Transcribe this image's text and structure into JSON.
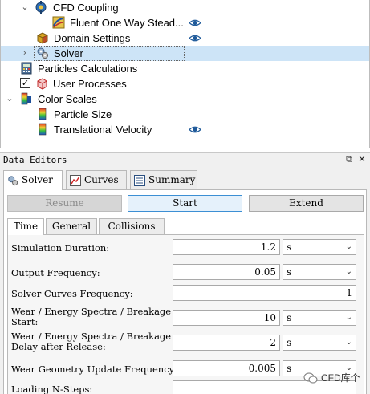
{
  "tree": {
    "items": [
      {
        "label": "CFD Coupling",
        "arrow": "⌄",
        "icon": "cfd-coupling-icon"
      },
      {
        "label": "Fluent One Way Stead...",
        "icon": "fluent-coupling-icon",
        "visible_eye": true
      },
      {
        "label": "Domain Settings",
        "icon": "domain-box-icon",
        "visible_eye": true
      },
      {
        "label": "Solver",
        "arrow": "›",
        "icon": "gears-icon",
        "selected": true
      },
      {
        "label": "Particles Calculations",
        "icon": "calculator-icon"
      },
      {
        "label": "User Processes",
        "icon": "user-process-icon",
        "checked": true
      },
      {
        "label": "Color Scales",
        "arrow": "⌄",
        "icon": "color-scale-icon"
      },
      {
        "label": "Particle Size",
        "icon": "color-scale-icon"
      },
      {
        "label": "Translational Velocity",
        "icon": "color-scale-icon",
        "visible_eye": true
      }
    ]
  },
  "data_editors": {
    "title": "Data Editors",
    "tabs": [
      {
        "label": "Solver",
        "icon": "gears-icon",
        "active": true
      },
      {
        "label": "Curves",
        "icon": "curves-icon"
      },
      {
        "label": "Summary",
        "icon": "summary-icon"
      }
    ],
    "buttons": {
      "resume": "Resume",
      "start": "Start",
      "extend": "Extend"
    },
    "subtabs": [
      "Time",
      "General",
      "Collisions"
    ],
    "params": [
      {
        "label": "Simulation Duration:",
        "value": "1.2",
        "unit": "s"
      },
      {
        "label": "Output Frequency:",
        "value": "0.05",
        "unit": "s"
      },
      {
        "label": "Solver Curves Frequency:",
        "value": "1",
        "unit": ""
      },
      {
        "label": "Wear / Energy Spectra / Breakage",
        "label2": "Start:",
        "value": "10",
        "unit": "s"
      },
      {
        "label": "Wear / Energy Spectra / Breakage",
        "label2": "Delay after Release:",
        "value": "2",
        "unit": "s"
      },
      {
        "label": "Wear Geometry Update Frequency:",
        "value": "0.005",
        "unit": "s"
      },
      {
        "label": "Loading N-Steps:",
        "value": "",
        "unit": ""
      }
    ]
  },
  "watermark": {
    "text": "CFD库个"
  },
  "colors": {
    "selection": "#cde4f7",
    "start_border": "#3c8fd4",
    "panel_bg": "#f0f0f0"
  }
}
